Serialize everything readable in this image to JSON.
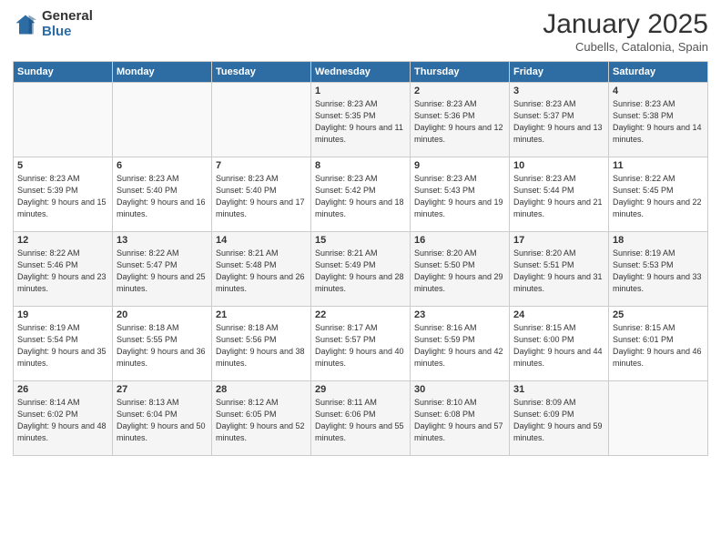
{
  "logo": {
    "general": "General",
    "blue": "Blue"
  },
  "header": {
    "month": "January 2025",
    "location": "Cubells, Catalonia, Spain"
  },
  "days_of_week": [
    "Sunday",
    "Monday",
    "Tuesday",
    "Wednesday",
    "Thursday",
    "Friday",
    "Saturday"
  ],
  "weeks": [
    [
      {
        "day": "",
        "sunrise": "",
        "sunset": "",
        "daylight": ""
      },
      {
        "day": "",
        "sunrise": "",
        "sunset": "",
        "daylight": ""
      },
      {
        "day": "",
        "sunrise": "",
        "sunset": "",
        "daylight": ""
      },
      {
        "day": "1",
        "sunrise": "Sunrise: 8:23 AM",
        "sunset": "Sunset: 5:35 PM",
        "daylight": "Daylight: 9 hours and 11 minutes."
      },
      {
        "day": "2",
        "sunrise": "Sunrise: 8:23 AM",
        "sunset": "Sunset: 5:36 PM",
        "daylight": "Daylight: 9 hours and 12 minutes."
      },
      {
        "day": "3",
        "sunrise": "Sunrise: 8:23 AM",
        "sunset": "Sunset: 5:37 PM",
        "daylight": "Daylight: 9 hours and 13 minutes."
      },
      {
        "day": "4",
        "sunrise": "Sunrise: 8:23 AM",
        "sunset": "Sunset: 5:38 PM",
        "daylight": "Daylight: 9 hours and 14 minutes."
      }
    ],
    [
      {
        "day": "5",
        "sunrise": "Sunrise: 8:23 AM",
        "sunset": "Sunset: 5:39 PM",
        "daylight": "Daylight: 9 hours and 15 minutes."
      },
      {
        "day": "6",
        "sunrise": "Sunrise: 8:23 AM",
        "sunset": "Sunset: 5:40 PM",
        "daylight": "Daylight: 9 hours and 16 minutes."
      },
      {
        "day": "7",
        "sunrise": "Sunrise: 8:23 AM",
        "sunset": "Sunset: 5:40 PM",
        "daylight": "Daylight: 9 hours and 17 minutes."
      },
      {
        "day": "8",
        "sunrise": "Sunrise: 8:23 AM",
        "sunset": "Sunset: 5:42 PM",
        "daylight": "Daylight: 9 hours and 18 minutes."
      },
      {
        "day": "9",
        "sunrise": "Sunrise: 8:23 AM",
        "sunset": "Sunset: 5:43 PM",
        "daylight": "Daylight: 9 hours and 19 minutes."
      },
      {
        "day": "10",
        "sunrise": "Sunrise: 8:23 AM",
        "sunset": "Sunset: 5:44 PM",
        "daylight": "Daylight: 9 hours and 21 minutes."
      },
      {
        "day": "11",
        "sunrise": "Sunrise: 8:22 AM",
        "sunset": "Sunset: 5:45 PM",
        "daylight": "Daylight: 9 hours and 22 minutes."
      }
    ],
    [
      {
        "day": "12",
        "sunrise": "Sunrise: 8:22 AM",
        "sunset": "Sunset: 5:46 PM",
        "daylight": "Daylight: 9 hours and 23 minutes."
      },
      {
        "day": "13",
        "sunrise": "Sunrise: 8:22 AM",
        "sunset": "Sunset: 5:47 PM",
        "daylight": "Daylight: 9 hours and 25 minutes."
      },
      {
        "day": "14",
        "sunrise": "Sunrise: 8:21 AM",
        "sunset": "Sunset: 5:48 PM",
        "daylight": "Daylight: 9 hours and 26 minutes."
      },
      {
        "day": "15",
        "sunrise": "Sunrise: 8:21 AM",
        "sunset": "Sunset: 5:49 PM",
        "daylight": "Daylight: 9 hours and 28 minutes."
      },
      {
        "day": "16",
        "sunrise": "Sunrise: 8:20 AM",
        "sunset": "Sunset: 5:50 PM",
        "daylight": "Daylight: 9 hours and 29 minutes."
      },
      {
        "day": "17",
        "sunrise": "Sunrise: 8:20 AM",
        "sunset": "Sunset: 5:51 PM",
        "daylight": "Daylight: 9 hours and 31 minutes."
      },
      {
        "day": "18",
        "sunrise": "Sunrise: 8:19 AM",
        "sunset": "Sunset: 5:53 PM",
        "daylight": "Daylight: 9 hours and 33 minutes."
      }
    ],
    [
      {
        "day": "19",
        "sunrise": "Sunrise: 8:19 AM",
        "sunset": "Sunset: 5:54 PM",
        "daylight": "Daylight: 9 hours and 35 minutes."
      },
      {
        "day": "20",
        "sunrise": "Sunrise: 8:18 AM",
        "sunset": "Sunset: 5:55 PM",
        "daylight": "Daylight: 9 hours and 36 minutes."
      },
      {
        "day": "21",
        "sunrise": "Sunrise: 8:18 AM",
        "sunset": "Sunset: 5:56 PM",
        "daylight": "Daylight: 9 hours and 38 minutes."
      },
      {
        "day": "22",
        "sunrise": "Sunrise: 8:17 AM",
        "sunset": "Sunset: 5:57 PM",
        "daylight": "Daylight: 9 hours and 40 minutes."
      },
      {
        "day": "23",
        "sunrise": "Sunrise: 8:16 AM",
        "sunset": "Sunset: 5:59 PM",
        "daylight": "Daylight: 9 hours and 42 minutes."
      },
      {
        "day": "24",
        "sunrise": "Sunrise: 8:15 AM",
        "sunset": "Sunset: 6:00 PM",
        "daylight": "Daylight: 9 hours and 44 minutes."
      },
      {
        "day": "25",
        "sunrise": "Sunrise: 8:15 AM",
        "sunset": "Sunset: 6:01 PM",
        "daylight": "Daylight: 9 hours and 46 minutes."
      }
    ],
    [
      {
        "day": "26",
        "sunrise": "Sunrise: 8:14 AM",
        "sunset": "Sunset: 6:02 PM",
        "daylight": "Daylight: 9 hours and 48 minutes."
      },
      {
        "day": "27",
        "sunrise": "Sunrise: 8:13 AM",
        "sunset": "Sunset: 6:04 PM",
        "daylight": "Daylight: 9 hours and 50 minutes."
      },
      {
        "day": "28",
        "sunrise": "Sunrise: 8:12 AM",
        "sunset": "Sunset: 6:05 PM",
        "daylight": "Daylight: 9 hours and 52 minutes."
      },
      {
        "day": "29",
        "sunrise": "Sunrise: 8:11 AM",
        "sunset": "Sunset: 6:06 PM",
        "daylight": "Daylight: 9 hours and 55 minutes."
      },
      {
        "day": "30",
        "sunrise": "Sunrise: 8:10 AM",
        "sunset": "Sunset: 6:08 PM",
        "daylight": "Daylight: 9 hours and 57 minutes."
      },
      {
        "day": "31",
        "sunrise": "Sunrise: 8:09 AM",
        "sunset": "Sunset: 6:09 PM",
        "daylight": "Daylight: 9 hours and 59 minutes."
      },
      {
        "day": "",
        "sunrise": "",
        "sunset": "",
        "daylight": ""
      }
    ]
  ]
}
